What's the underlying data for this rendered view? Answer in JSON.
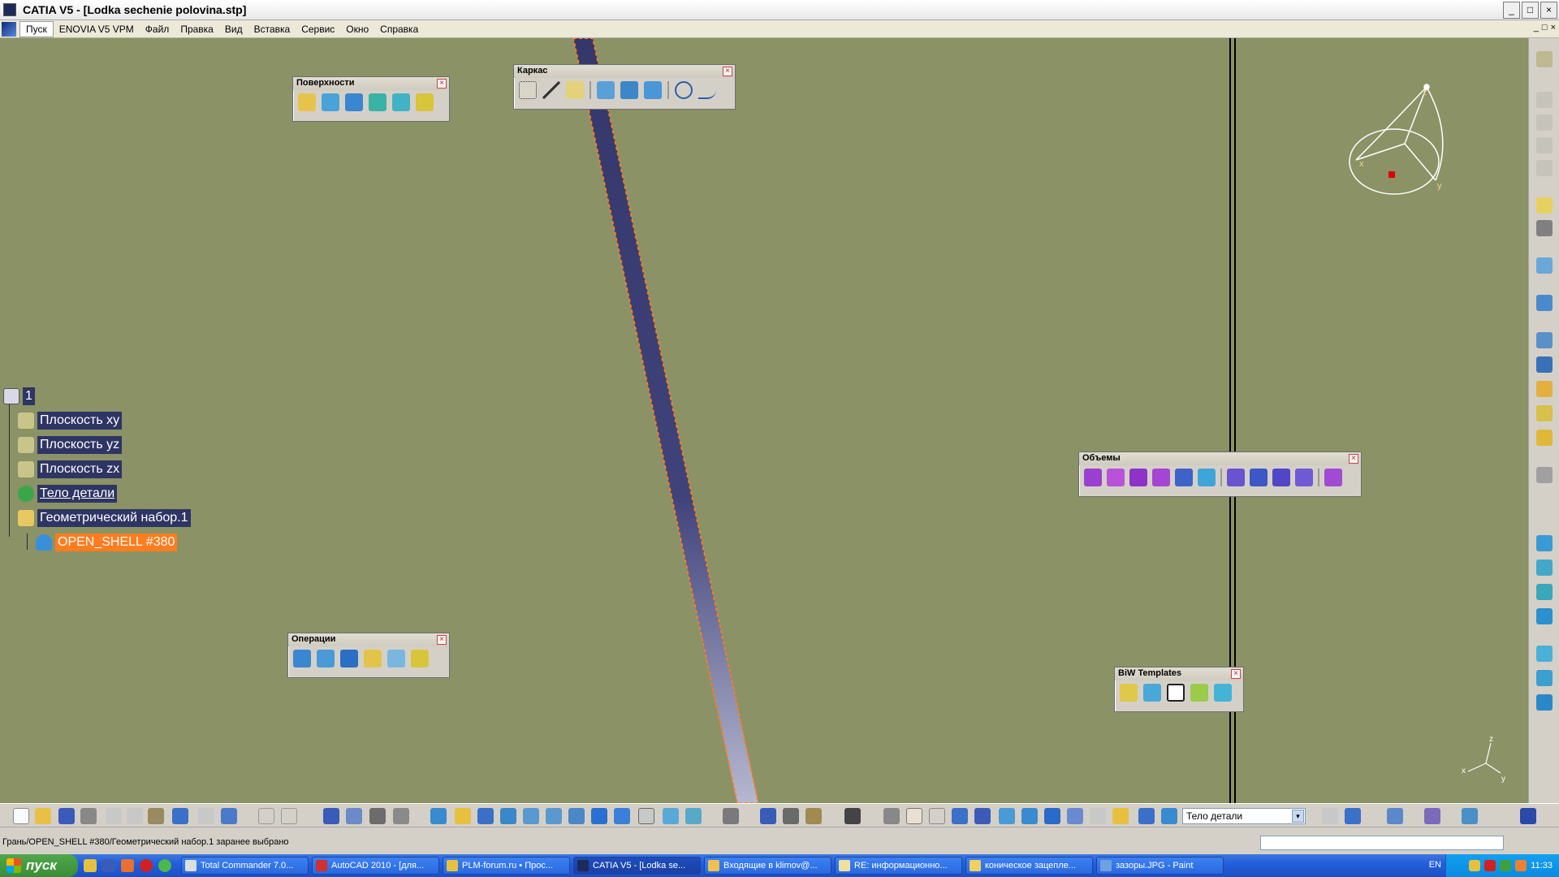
{
  "window": {
    "title": "CATIA V5 - [Lodka sechenie polovina.stp]",
    "minimize": "_",
    "maximize": "□",
    "close": "×"
  },
  "menu": {
    "items": [
      "Пуск",
      "ENOVIA V5 VPM",
      "Файл",
      "Правка",
      "Вид",
      "Вставка",
      "Сервис",
      "Окно",
      "Справка"
    ],
    "mdi_buttons": [
      "_",
      "□",
      "×"
    ]
  },
  "toolbars": {
    "surfaces": {
      "title": "Поверхности"
    },
    "wireframe": {
      "title": "Каркас"
    },
    "volumes": {
      "title": "Объемы"
    },
    "operations": {
      "title": "Операции"
    },
    "biw": {
      "title": "BiW Templates"
    },
    "close_glyph": "×"
  },
  "tree": {
    "root": "1",
    "items": [
      {
        "label": "Плоскость xy"
      },
      {
        "label": "Плоскость yz"
      },
      {
        "label": "Плоскость zx"
      },
      {
        "label": "Тело детали"
      },
      {
        "label": "Геометрический набор.1"
      },
      {
        "label": "OPEN_SHELL #380"
      }
    ]
  },
  "compass": {
    "x": "x",
    "y": "y",
    "z": "z"
  },
  "axis_triad": {
    "x": "x",
    "y": "y",
    "z": "z"
  },
  "bottom_toolbar": {
    "current_body": "Тело детали",
    "select_arrow": "▾"
  },
  "status": {
    "text": "Грань/OPEN_SHELL #380/Геометрический набор.1 заранее выбрано"
  },
  "taskbar": {
    "start_label": "пуск",
    "tasks": [
      {
        "label": "Total Commander 7.0...",
        "active": false
      },
      {
        "label": "AutoCAD 2010 - [для...",
        "active": false
      },
      {
        "label": "PLM-forum.ru • Прос...",
        "active": false
      },
      {
        "label": "CATIA V5 - [Lodka se...",
        "active": true
      },
      {
        "label": "Входящие в klimov@...",
        "active": false
      },
      {
        "label": "RE: информационно...",
        "active": false
      },
      {
        "label": "коническое зацепле...",
        "active": false
      },
      {
        "label": "зазоры.JPG - Paint",
        "active": false
      }
    ],
    "language": "EN",
    "clock": "11:33"
  },
  "colors": {
    "viewport_bg": "#8a9266",
    "tree_label_bg": "#2e3564",
    "highlight": "#ff7c1f",
    "shell_fill": "#3a3d6e"
  }
}
